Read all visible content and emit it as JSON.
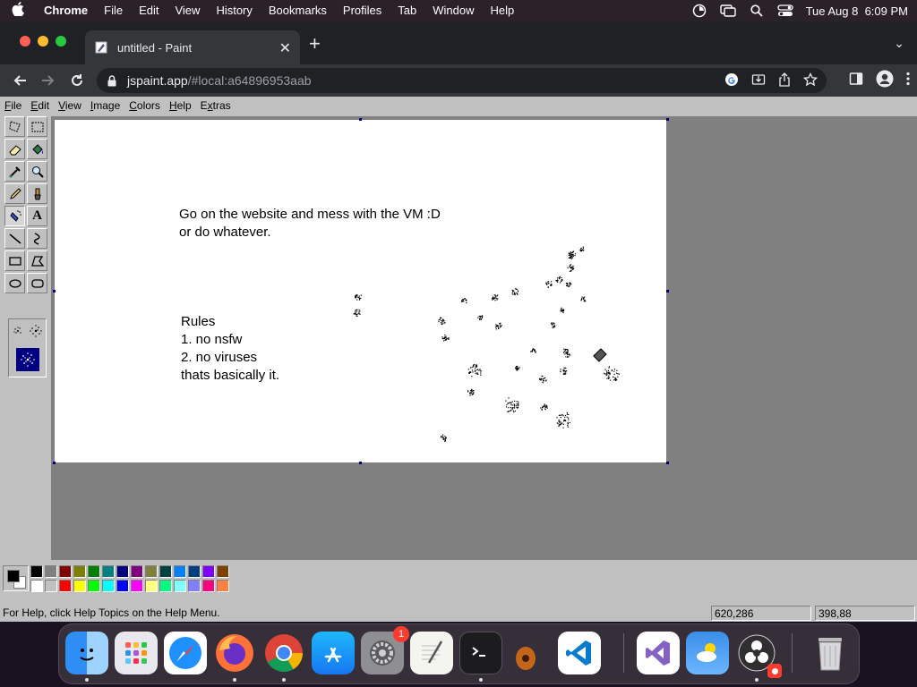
{
  "macos_menubar": {
    "app": "Chrome",
    "items": [
      "File",
      "Edit",
      "View",
      "History",
      "Bookmarks",
      "Profiles",
      "Tab",
      "Window",
      "Help"
    ],
    "datetime": "Tue Aug 8  6:09 PM"
  },
  "browser": {
    "tab_title": "untitled - Paint",
    "url_host": "jspaint.app",
    "url_path": "/#local:a64896953aab"
  },
  "paint": {
    "menu": [
      {
        "pre": "",
        "u": "F",
        "post": "ile"
      },
      {
        "pre": "",
        "u": "E",
        "post": "dit"
      },
      {
        "pre": "",
        "u": "V",
        "post": "iew"
      },
      {
        "pre": "",
        "u": "I",
        "post": "mage"
      },
      {
        "pre": "",
        "u": "C",
        "post": "olors"
      },
      {
        "pre": "",
        "u": "H",
        "post": "elp"
      },
      {
        "pre": "E",
        "u": "x",
        "post": "tras"
      }
    ],
    "canvas_text_1": "Go on the website and mess with the VM :D\nor do whatever.",
    "canvas_text_2": "Rules\n1. no nsfw\n2. no viruses\nthats basically it.",
    "status_help": "For Help, click Help Topics on the Help Menu.",
    "status_position": "620,286",
    "status_size": "398,88",
    "palette_top": [
      "#000000",
      "#808080",
      "#800000",
      "#808000",
      "#008000",
      "#008080",
      "#000080",
      "#800080",
      "#808040",
      "#004040",
      "#0080ff",
      "#004080",
      "#8000ff",
      "#804000"
    ],
    "palette_bottom": [
      "#ffffff",
      "#c0c0c0",
      "#ff0000",
      "#ffff00",
      "#00ff00",
      "#00ffff",
      "#0000ff",
      "#ff00ff",
      "#ffff80",
      "#00ff80",
      "#80ffff",
      "#8080ff",
      "#ff0080",
      "#ff8040"
    ],
    "primary_color": "#000000",
    "secondary_color": "#ffffff"
  },
  "dock": {
    "apps": [
      "finder",
      "launchpad",
      "safari",
      "firefox",
      "chrome",
      "app-store",
      "system-settings",
      "textedit",
      "terminal",
      "garageband",
      "vscode",
      "visual-studio",
      "weather",
      "obs",
      "trash"
    ],
    "settings_badge": "1"
  }
}
